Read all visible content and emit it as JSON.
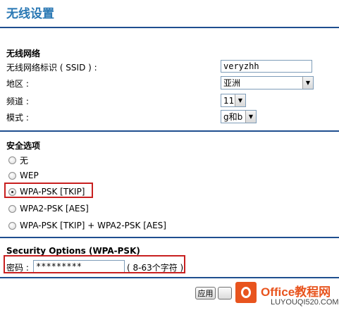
{
  "page": {
    "title": "无线设置"
  },
  "wireless": {
    "section_title": "无线网络",
    "ssid_label": "无线网络标识 ( SSID ) :",
    "ssid_value": "veryzhh",
    "region_label": "地区 :",
    "region_value": "亚洲",
    "channel_label": "频道 :",
    "channel_value": "11",
    "mode_label": "模式 :",
    "mode_value": "g和b"
  },
  "security": {
    "section_title": "安全选项",
    "options": [
      {
        "label": "无",
        "checked": false
      },
      {
        "label": "WEP",
        "checked": false
      },
      {
        "label": "WPA-PSK [TKIP]",
        "checked": true
      },
      {
        "label": "WPA2-PSK [AES]",
        "checked": false
      },
      {
        "label": "WPA-PSK [TKIP] + WPA2-PSK [AES]",
        "checked": false
      }
    ]
  },
  "wpa": {
    "section_title": "Security Options (WPA-PSK)",
    "password_label": "密码 :",
    "password_value": "*********",
    "hint": "( 8-63个字符 )"
  },
  "actions": {
    "apply_label": "应用"
  },
  "watermark": {
    "name": "Office教程网",
    "site": "LUYOUQI520.COM"
  },
  "colors": {
    "title": "#2a78b4",
    "rule": "#1f4f8f",
    "highlight": "#c82020",
    "watermark": "#e8541e"
  }
}
